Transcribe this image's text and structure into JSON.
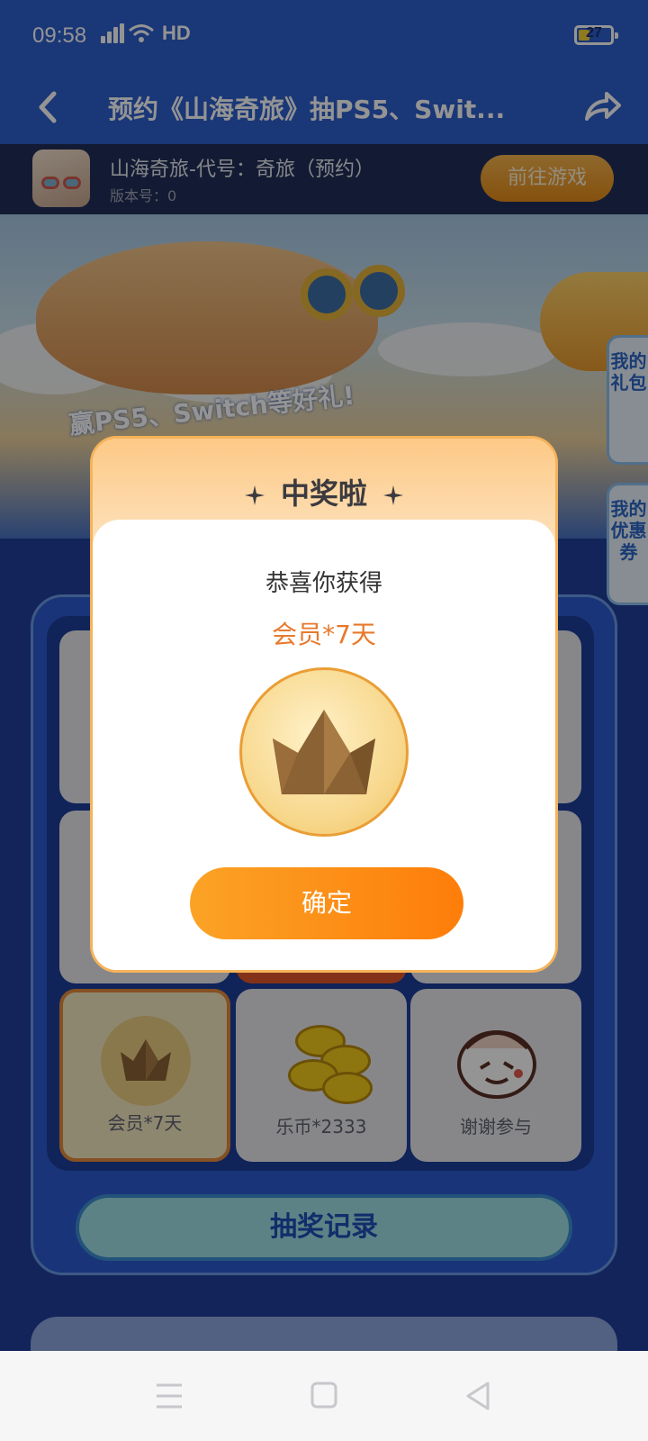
{
  "status_bar": {
    "time": "09:58",
    "network": "4G",
    "hd": "HD",
    "battery": "27"
  },
  "header": {
    "title": "预约《山海奇旅》抽PS5、Swit...",
    "back_icon": "back-arrow-icon",
    "share_icon": "share-icon"
  },
  "game": {
    "name": "山海奇旅-代号：奇旅（预约）",
    "version": "版本号：0",
    "button": "前往游戏"
  },
  "banner": {
    "text": "赢PS5、Switch等好礼!"
  },
  "side_tabs": {
    "gifts": "我的礼包",
    "coupons": "我的优惠券"
  },
  "grid": {
    "cells": [
      {
        "label": "会员*7天",
        "icon": "crown-icon",
        "active": true
      },
      {
        "label": "乐币*2333",
        "icon": "coins-icon",
        "active": false
      },
      {
        "label": "谢谢参与",
        "icon": "mascot-icon",
        "active": false
      }
    ],
    "record_button": "抽奖记录"
  },
  "modal": {
    "title": "中奖啦",
    "congrats": "恭喜你获得",
    "prize": "会员*7天",
    "prize_icon": "crown-icon",
    "confirm": "确定"
  },
  "nav": {
    "menu_icon": "menu-icon",
    "home_icon": "home-square-icon",
    "back_icon": "back-triangle-icon"
  },
  "colors": {
    "header_blue": "#2e5fce",
    "accent_orange": "#fe7d0a",
    "prize_orange": "#e8792b"
  }
}
